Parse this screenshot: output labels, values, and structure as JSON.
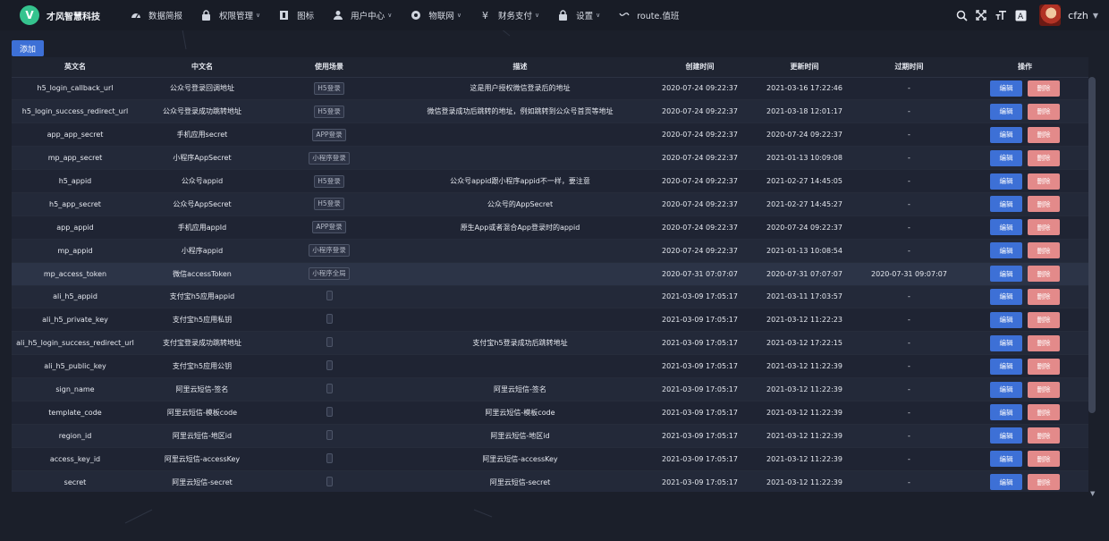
{
  "brand": {
    "logo": "V",
    "name": "才风智慧科技",
    "logo_color": "#35c38e"
  },
  "menu": [
    {
      "label": "数据简报",
      "icon": "dashboard-icon",
      "caret": false
    },
    {
      "label": "权限管理",
      "icon": "lock-icon",
      "caret": true
    },
    {
      "label": "图标",
      "icon": "image-icon",
      "caret": false
    },
    {
      "label": "用户中心",
      "icon": "user-icon",
      "caret": true
    },
    {
      "label": "物联网",
      "icon": "settings-gear-icon",
      "caret": true
    },
    {
      "label": "财务支付",
      "icon": "yen-icon",
      "caret": true
    },
    {
      "label": "设置",
      "icon": "lock-icon",
      "caret": true
    },
    {
      "label": "route.值班",
      "icon": "wave-icon",
      "caret": false
    }
  ],
  "tools": [
    "search-icon",
    "fullscreen-icon",
    "font-size-icon",
    "translate-icon"
  ],
  "user": {
    "name": "cfzh"
  },
  "add_label": "添加",
  "table": {
    "headers": [
      "英文名",
      "中文名",
      "使用场景",
      "描述",
      "创建时间",
      "更新时间",
      "过期时间",
      "操作"
    ],
    "edit_label": "编辑",
    "delete_label": "删除",
    "rows": [
      {
        "en": "h5_login_callback_url",
        "cn": "公众号登录回调地址",
        "scene": "H5登录",
        "desc": "这是用户授权微信登录后的地址",
        "created": "2020-07-24 09:22:37",
        "updated": "2021-03-16 17:22:46",
        "expire": "-"
      },
      {
        "en": "h5_login_success_redirect_url",
        "cn": "公众号登录成功跳转地址",
        "scene": "H5登录",
        "desc": "微信登录成功后跳转的地址，例如跳转到公众号首页等地址",
        "created": "2020-07-24 09:22:37",
        "updated": "2021-03-18 12:01:17",
        "expire": "-"
      },
      {
        "en": "app_app_secret",
        "cn": "手机应用secret",
        "scene": "APP登录",
        "desc": "",
        "created": "2020-07-24 09:22:37",
        "updated": "2020-07-24 09:22:37",
        "expire": "-"
      },
      {
        "en": "mp_app_secret",
        "cn": "小程序AppSecret",
        "scene": "小程序登录",
        "desc": "",
        "created": "2020-07-24 09:22:37",
        "updated": "2021-01-13 10:09:08",
        "expire": "-"
      },
      {
        "en": "h5_appid",
        "cn": "公众号appid",
        "scene": "H5登录",
        "desc": "公众号appid跟小程序appid不一样，要注意",
        "created": "2020-07-24 09:22:37",
        "updated": "2021-02-27 14:45:05",
        "expire": "-"
      },
      {
        "en": "h5_app_secret",
        "cn": "公众号AppSecret",
        "scene": "H5登录",
        "desc": "公众号的AppSecret",
        "created": "2020-07-24 09:22:37",
        "updated": "2021-02-27 14:45:27",
        "expire": "-"
      },
      {
        "en": "app_appid",
        "cn": "手机应用appId",
        "scene": "APP登录",
        "desc": "原生App或者混合App登录时的appid",
        "created": "2020-07-24 09:22:37",
        "updated": "2020-07-24 09:22:37",
        "expire": "-"
      },
      {
        "en": "mp_appid",
        "cn": "小程序appid",
        "scene": "小程序登录",
        "desc": "",
        "created": "2020-07-24 09:22:37",
        "updated": "2021-01-13 10:08:54",
        "expire": "-"
      },
      {
        "en": "mp_access_token",
        "cn": "微信accessToken",
        "scene": "小程序全局",
        "desc": "",
        "created": "2020-07-31 07:07:07",
        "updated": "2020-07-31 07:07:07",
        "expire": "2020-07-31 09:07:07"
      },
      {
        "en": "ali_h5_appid",
        "cn": "支付宝h5应用appid",
        "scene": "",
        "desc": "",
        "created": "2021-03-09 17:05:17",
        "updated": "2021-03-11 17:03:57",
        "expire": "-"
      },
      {
        "en": "ali_h5_private_key",
        "cn": "支付宝h5应用私钥",
        "scene": "",
        "desc": "",
        "created": "2021-03-09 17:05:17",
        "updated": "2021-03-12 11:22:23",
        "expire": "-"
      },
      {
        "en": "ali_h5_login_success_redirect_url",
        "cn": "支付宝登录成功跳转地址",
        "scene": "",
        "desc": "支付宝h5登录成功后跳转地址",
        "created": "2021-03-09 17:05:17",
        "updated": "2021-03-12 17:22:15",
        "expire": "-"
      },
      {
        "en": "ali_h5_public_key",
        "cn": "支付宝h5应用公钥",
        "scene": "",
        "desc": "",
        "created": "2021-03-09 17:05:17",
        "updated": "2021-03-12 11:22:39",
        "expire": "-"
      },
      {
        "en": "sign_name",
        "cn": "阿里云短信-签名",
        "scene": "",
        "desc": "阿里云短信-签名",
        "created": "2021-03-09 17:05:17",
        "updated": "2021-03-12 11:22:39",
        "expire": "-"
      },
      {
        "en": "template_code",
        "cn": "阿里云短信-模板code",
        "scene": "",
        "desc": "阿里云短信-模板code",
        "created": "2021-03-09 17:05:17",
        "updated": "2021-03-12 11:22:39",
        "expire": "-"
      },
      {
        "en": "region_id",
        "cn": "阿里云短信-地区id",
        "scene": "",
        "desc": "阿里云短信-地区id",
        "created": "2021-03-09 17:05:17",
        "updated": "2021-03-12 11:22:39",
        "expire": "-"
      },
      {
        "en": "access_key_id",
        "cn": "阿里云短信-accessKey",
        "scene": "",
        "desc": "阿里云短信-accessKey",
        "created": "2021-03-09 17:05:17",
        "updated": "2021-03-12 11:22:39",
        "expire": "-"
      },
      {
        "en": "secret",
        "cn": "阿里云短信-secret",
        "scene": "",
        "desc": "阿里云短信-secret",
        "created": "2021-03-09 17:05:17",
        "updated": "2021-03-12 11:22:39",
        "expire": "-"
      }
    ]
  },
  "colors": {
    "primary": "#3d70d6",
    "danger": "#e38a8a",
    "background": "#1b1f2a"
  }
}
